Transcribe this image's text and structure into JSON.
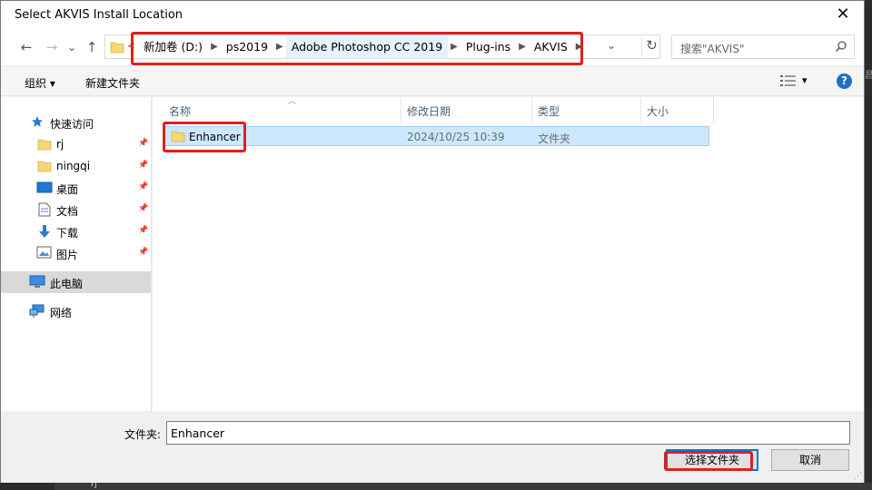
{
  "window": {
    "title": "Select AKVIS Install Location",
    "close_glyph": "✕"
  },
  "navigation": {
    "back": "←",
    "forward": "→",
    "recent": "⌄",
    "up": "↑",
    "overflow": "<",
    "breadcrumbs": [
      "新加卷 (D:)",
      "ps2019",
      "Adobe Photoshop CC 2019",
      "Plug-ins",
      "AKVIS"
    ],
    "dropdown": "⌄",
    "refresh": "↻",
    "search_placeholder": "搜索\"AKVIS\""
  },
  "toolbar": {
    "organize": "组织 ▾",
    "new_folder": "新建文件夹",
    "view_caret": "▾",
    "help": "?"
  },
  "sidebar": {
    "quick_access": "快速访问",
    "items": [
      {
        "label": "rj",
        "icon": "folder-icon"
      },
      {
        "label": "ningqi",
        "icon": "folder-icon"
      },
      {
        "label": "桌面",
        "icon": "desktop-icon"
      },
      {
        "label": "文档",
        "icon": "document-icon"
      },
      {
        "label": "下载",
        "icon": "download-icon"
      },
      {
        "label": "图片",
        "icon": "pictures-icon"
      }
    ],
    "this_pc": "此电脑",
    "network": "网络"
  },
  "columns": {
    "name": "名称",
    "modified": "修改日期",
    "type": "类型",
    "size": "大小"
  },
  "files": [
    {
      "name": "Enhancer",
      "modified": "2024/10/25 10:39",
      "type": "文件夹",
      "size": ""
    }
  ],
  "footer": {
    "folder_label": "文件夹:",
    "folder_value": "Enhancer",
    "select_button": "选择文件夹",
    "cancel_button": "取消"
  },
  "background": {
    "peek_item": "rj",
    "edge_char": "昌"
  },
  "colors": {
    "accent": "#0078d7",
    "selection": "#cce8ff",
    "annotation": "#e0201c",
    "folder": "#f7d774"
  }
}
